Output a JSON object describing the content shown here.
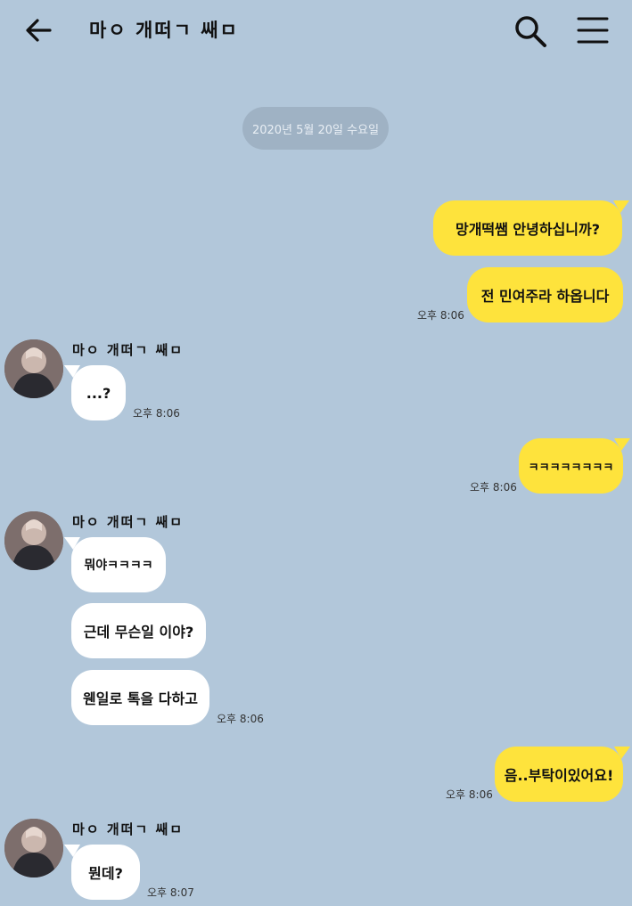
{
  "header": {
    "title": "마ㅇ 개떠ㄱ 쌔ㅁ"
  },
  "date_divider": "2020년 5월 20일 수요일",
  "messages": {
    "m1": {
      "text": "망개떡쌤 안녕하십니까?"
    },
    "m2": {
      "text": "전 민여주라 하옵니다",
      "time": "오후 8:06"
    },
    "r1_sender": "마ㅇ 개떠ㄱ 쌔ㅁ",
    "r1": {
      "text": "...?",
      "time": "오후 8:06"
    },
    "m3": {
      "text": "ㅋㅋㅋㅋㅋㅋㅋㅋ",
      "time": "오후 8:06"
    },
    "r2_sender": "마ㅇ 개떠ㄱ 쌔ㅁ",
    "r2a": {
      "text": "뭐야ㅋㅋㅋㅋ"
    },
    "r2b": {
      "text": "근데 무슨일 이야?"
    },
    "r2c": {
      "text": "웬일로 톡을 다하고",
      "time": "오후 8:06"
    },
    "m4": {
      "text": "음..부탁이있어요!",
      "time": "오후 8:06"
    },
    "r3_sender": "마ㅇ 개떠ㄱ 쌔ㅁ",
    "r3": {
      "text": "뭔데?",
      "time": "오후 8:07"
    }
  },
  "icons": {
    "back": "arrow-left-icon",
    "search": "search-icon",
    "menu": "hamburger-menu-icon"
  },
  "colors": {
    "background": "#b2c7da",
    "my_bubble": "#fee33c",
    "their_bubble": "#ffffff",
    "date_pill": "#9fb2c4"
  }
}
